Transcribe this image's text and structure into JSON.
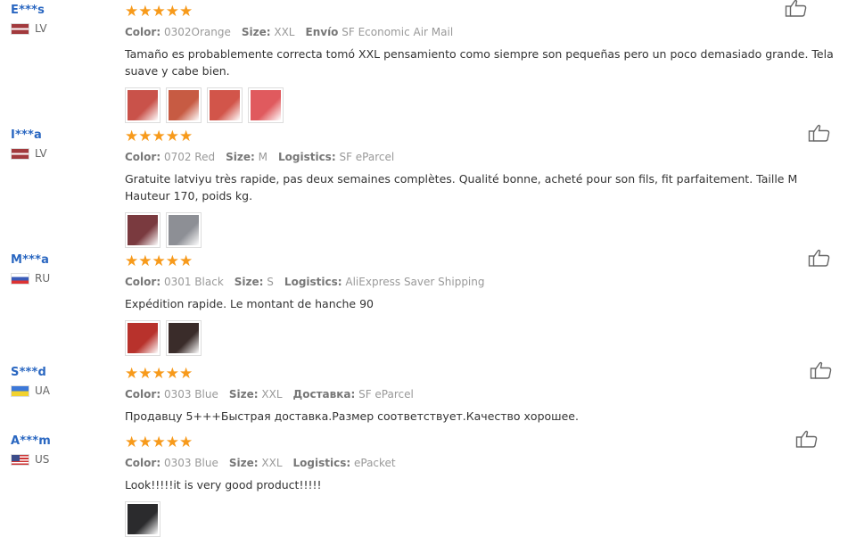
{
  "reviews": [
    {
      "user": "E***s",
      "country": "LV",
      "flag": "lv",
      "stars": "★★★★★",
      "color_label": "Color:",
      "color": "0302Orange",
      "size_label": "Size:",
      "size": "XXL",
      "ship_label": "Envío",
      "ship": "SF Economic Air Mail",
      "text": "Tamaño es probablemente correcta tomó XXL pensamiento como siempre son pequeñas pero un poco demasiado grande. Tela suave y cabe bien.",
      "photos": [
        "#c9524a",
        "#c75b43",
        "#d2554a",
        "#e05a5e"
      ]
    },
    {
      "user": "I***a",
      "country": "LV",
      "flag": "lv",
      "stars": "★★★★★",
      "color_label": "Color:",
      "color": "0702 Red",
      "size_label": "Size:",
      "size": "M",
      "ship_label": "Logistics:",
      "ship": "SF eParcel",
      "text": "Gratuite latviyu très rapide, pas deux semaines complètes. Qualité bonne, acheté pour son fils, fit parfaitement. Taille M Hauteur 170, poids kg.",
      "photos": [
        "#7a3a3f",
        "#8d8f95"
      ]
    },
    {
      "user": "M***a",
      "country": "RU",
      "flag": "ru",
      "stars": "★★★★★",
      "color_label": "Color:",
      "color": "0301 Black",
      "size_label": "Size:",
      "size": "S",
      "ship_label": "Logistics:",
      "ship": "AliExpress Saver Shipping",
      "text": "Expédition rapide. Le montant de hanche 90",
      "photos": [
        "#b8322c",
        "#3a2c2a"
      ]
    },
    {
      "user": "S***d",
      "country": "UA",
      "flag": "ua",
      "stars": "★★★★★",
      "color_label": "Color:",
      "color": "0303 Blue",
      "size_label": "Size:",
      "size": "XXL",
      "ship_label": "Доставка:",
      "ship": "SF eParcel",
      "text": "Продавцу 5+++Быстрая доставка.Размер соответствует.Качество хорошее.",
      "photos": []
    },
    {
      "user": "A***m",
      "country": "US",
      "flag": "us",
      "stars": "★★★★★",
      "color_label": "Color:",
      "color": "0303 Blue",
      "size_label": "Size:",
      "size": "XXL",
      "ship_label": "Logistics:",
      "ship": "ePacket",
      "text": "Look!!!!!it is very good product!!!!!",
      "photos": [
        "#2b2b2d"
      ]
    }
  ]
}
